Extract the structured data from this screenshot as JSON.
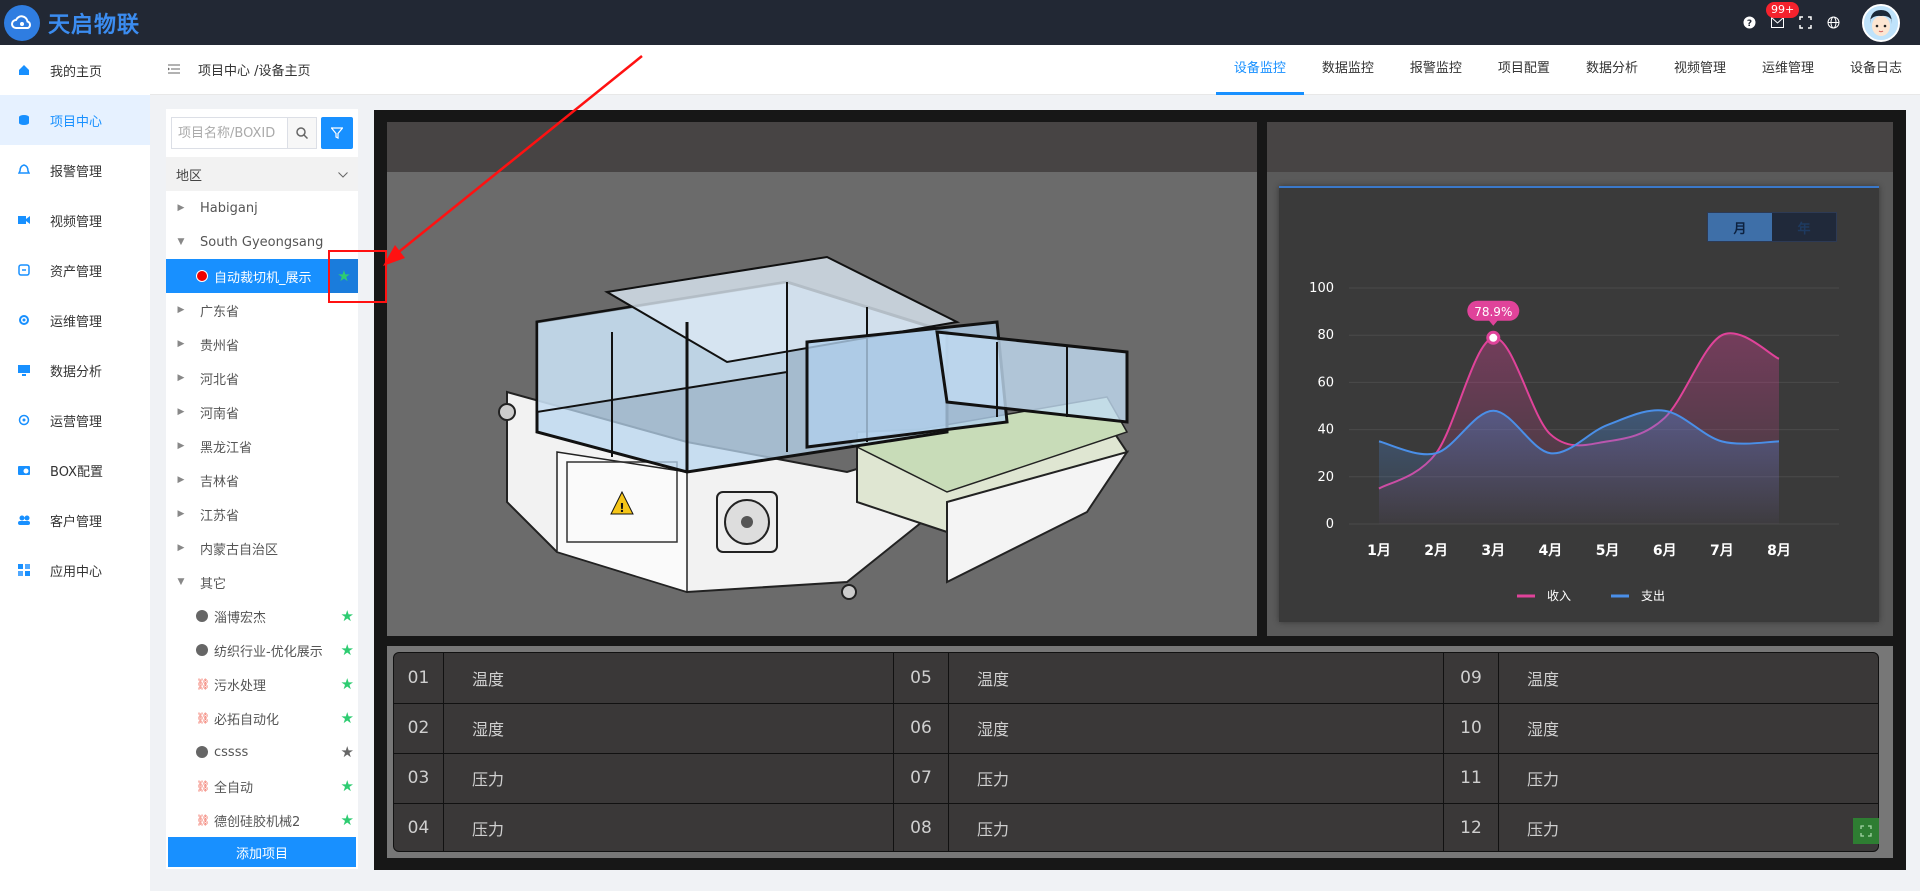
{
  "app": {
    "name": "天启物联",
    "notification_badge": "99+"
  },
  "nav": {
    "items": [
      {
        "label": "我的主页",
        "icon": "home-icon"
      },
      {
        "label": "项目中心",
        "icon": "database-icon",
        "active": true
      },
      {
        "label": "报警管理",
        "icon": "bell-icon"
      },
      {
        "label": "视频管理",
        "icon": "video-icon"
      },
      {
        "label": "资产管理",
        "icon": "asset-icon"
      },
      {
        "label": "运维管理",
        "icon": "wrench-icon"
      },
      {
        "label": "数据分析",
        "icon": "monitor-icon"
      },
      {
        "label": "运营管理",
        "icon": "cycle-icon"
      },
      {
        "label": "BOX配置",
        "icon": "box-icon"
      },
      {
        "label": "客户管理",
        "icon": "users-icon"
      },
      {
        "label": "应用中心",
        "icon": "apps-icon"
      }
    ]
  },
  "breadcrumb": "项目中心 /设备主页",
  "tabs": [
    "设备监控",
    "数据监控",
    "报警监控",
    "项目配置",
    "数据分析",
    "视频管理",
    "运维管理",
    "设备日志"
  ],
  "project_panel": {
    "search_placeholder": "项目名称/BOXID",
    "region_label": "地区",
    "tree": [
      {
        "label": "Habiganj",
        "type": "region",
        "expanded": false
      },
      {
        "label": "South Gyeongsang",
        "type": "region",
        "expanded": true
      },
      {
        "label": "自动裁切机_展示",
        "type": "project",
        "status": "alarm",
        "starred": true,
        "selected": true
      },
      {
        "label": "广东省",
        "type": "region",
        "expanded": false
      },
      {
        "label": "贵州省",
        "type": "region",
        "expanded": false
      },
      {
        "label": "河北省",
        "type": "region",
        "expanded": false
      },
      {
        "label": "河南省",
        "type": "region",
        "expanded": false
      },
      {
        "label": "黑龙江省",
        "type": "region",
        "expanded": false
      },
      {
        "label": "吉林省",
        "type": "region",
        "expanded": false
      },
      {
        "label": "江苏省",
        "type": "region",
        "expanded": false
      },
      {
        "label": "内蒙古自治区",
        "type": "region",
        "expanded": false
      },
      {
        "label": "其它",
        "type": "region",
        "expanded": true
      },
      {
        "label": "淄博宏杰",
        "type": "project",
        "status": "offline",
        "starred": true
      },
      {
        "label": "纺织行业-优化展示",
        "type": "project",
        "status": "offline",
        "starred": true
      },
      {
        "label": "污水处理",
        "type": "project",
        "status": "link",
        "starred": true
      },
      {
        "label": "必拓自动化",
        "type": "project",
        "status": "link",
        "starred": true
      },
      {
        "label": "cssss",
        "type": "project",
        "status": "offline",
        "starred": false
      },
      {
        "label": "全自动",
        "type": "project",
        "status": "link",
        "starred": true
      },
      {
        "label": "德创硅胶机械2",
        "type": "project",
        "status": "link",
        "starred": true
      }
    ],
    "add_button": "添加项目"
  },
  "chart_toggle": {
    "month": "月",
    "year": "年"
  },
  "chart_data": {
    "type": "line",
    "categories": [
      "1月",
      "2月",
      "3月",
      "4月",
      "5月",
      "6月",
      "7月",
      "8月"
    ],
    "ylim": [
      0,
      100
    ],
    "yticks": [
      0,
      20,
      40,
      60,
      80,
      100
    ],
    "series": [
      {
        "name": "收入",
        "color": "#e0439a",
        "values": [
          15,
          30,
          78.9,
          38,
          35,
          45,
          80,
          70
        ]
      },
      {
        "name": "支出",
        "color": "#4a8fe8",
        "values": [
          35,
          30,
          48,
          30,
          42,
          48,
          35,
          35
        ]
      }
    ],
    "annotation": {
      "label": "78.9%",
      "category": "3月",
      "value": 78.9
    },
    "legend_position": "bottom"
  },
  "sensors": [
    [
      {
        "num": "01",
        "name": "温度"
      },
      {
        "num": "05",
        "name": "温度"
      },
      {
        "num": "09",
        "name": "温度"
      }
    ],
    [
      {
        "num": "02",
        "name": "湿度"
      },
      {
        "num": "06",
        "name": "湿度"
      },
      {
        "num": "10",
        "name": "湿度"
      }
    ],
    [
      {
        "num": "03",
        "name": "压力"
      },
      {
        "num": "07",
        "name": "压力"
      },
      {
        "num": "11",
        "name": "压力"
      }
    ],
    [
      {
        "num": "04",
        "name": "压力"
      },
      {
        "num": "08",
        "name": "压力"
      },
      {
        "num": "12",
        "name": "压力"
      }
    ]
  ]
}
